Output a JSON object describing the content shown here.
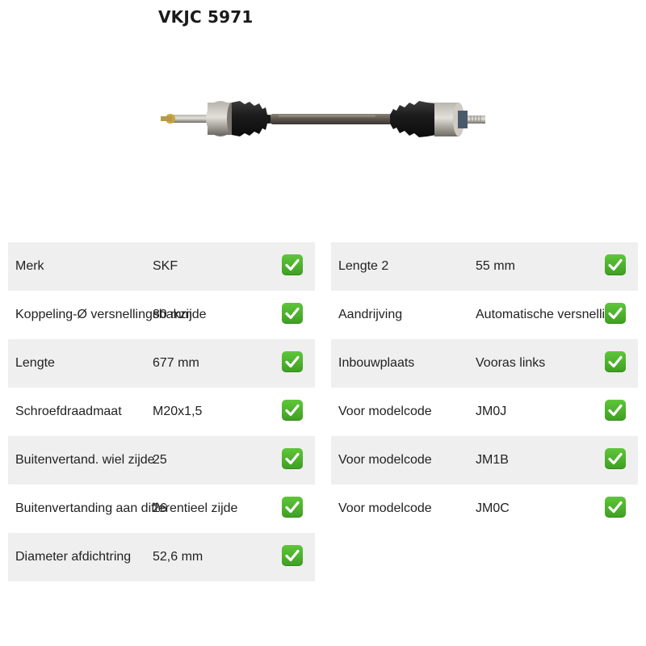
{
  "product": {
    "title": "VKJC 5971",
    "image_icon": "drive-shaft-image"
  },
  "check_icon": "check-mark-icon",
  "colors": {
    "check_green": "#4caf2b",
    "row_shade": "#efefef"
  },
  "specs_left": [
    {
      "label": "Merk",
      "value": "SKF"
    },
    {
      "label": "Koppeling-Ø versnellingsbakzijde",
      "value": "80 mm"
    },
    {
      "label": "Lengte",
      "value": "677 mm"
    },
    {
      "label": "Schroefdraadmaat",
      "value": "M20x1,5"
    },
    {
      "label": "Buitenvertand. wiel zijde",
      "value": "25"
    },
    {
      "label": "Buitenvertanding aan differentieel zijde",
      "value": "26"
    },
    {
      "label": "Diameter afdichtring",
      "value": "52,6 mm"
    }
  ],
  "specs_right": [
    {
      "label": "Lengte 2",
      "value": "55 mm"
    },
    {
      "label": "Aandrijving",
      "value": "Automatische versnellings"
    },
    {
      "label": "Inbouwplaats",
      "value": "Vooras links"
    },
    {
      "label": "Voor modelcode",
      "value": "JM0J"
    },
    {
      "label": "Voor modelcode",
      "value": "JM1B"
    },
    {
      "label": "Voor modelcode",
      "value": "JM0C"
    }
  ]
}
